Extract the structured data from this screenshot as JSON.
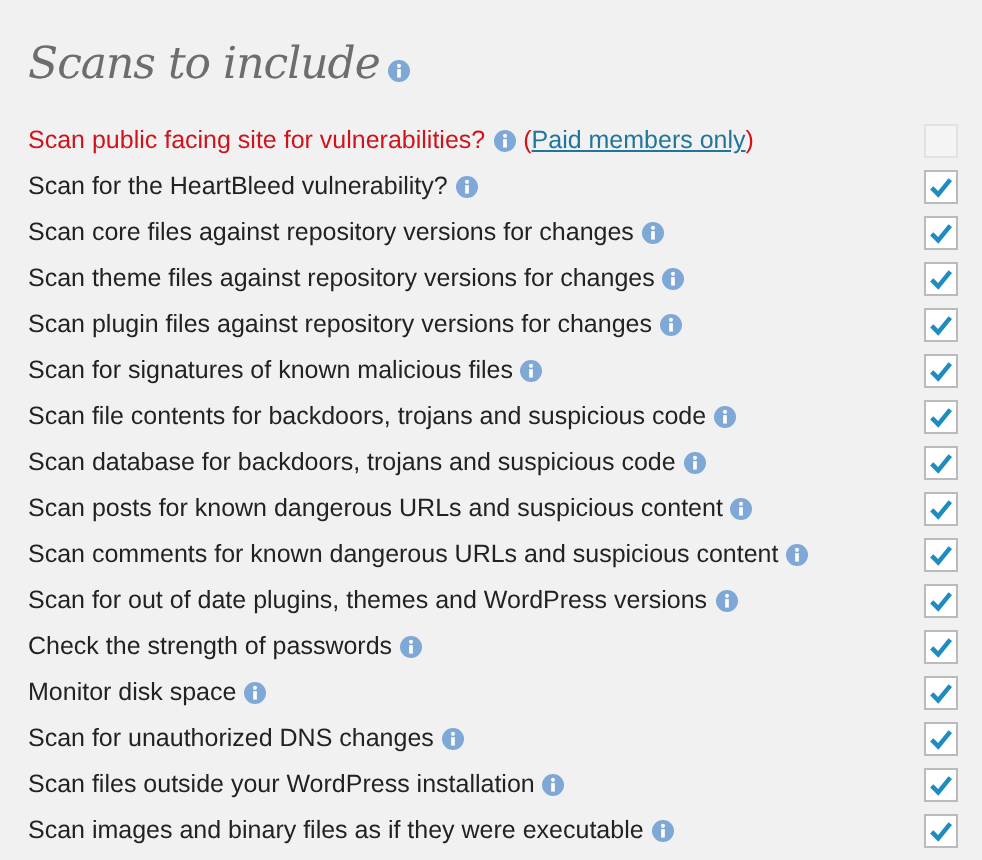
{
  "heading": {
    "text": "Scans to include"
  },
  "options": [
    {
      "kind": "paid",
      "label": "Scan public facing site for vulnerabilities?",
      "note_open": "(",
      "note_link": "Paid members only",
      "note_close": ")",
      "checked": false,
      "disabled": true
    },
    {
      "kind": "standard",
      "label": "Scan for the HeartBleed vulnerability?",
      "checked": true,
      "disabled": false
    },
    {
      "kind": "standard",
      "label": "Scan core files against repository versions for changes",
      "checked": true,
      "disabled": false
    },
    {
      "kind": "standard",
      "label": "Scan theme files against repository versions for changes",
      "checked": true,
      "disabled": false
    },
    {
      "kind": "standard",
      "label": "Scan plugin files against repository versions for changes",
      "checked": true,
      "disabled": false
    },
    {
      "kind": "standard",
      "label": "Scan for signatures of known malicious files",
      "checked": true,
      "disabled": false
    },
    {
      "kind": "standard",
      "label": "Scan file contents for backdoors, trojans and suspicious code",
      "checked": true,
      "disabled": false
    },
    {
      "kind": "standard",
      "label": "Scan database for backdoors, trojans and suspicious code",
      "checked": true,
      "disabled": false
    },
    {
      "kind": "standard",
      "label": "Scan posts for known dangerous URLs and suspicious content",
      "checked": true,
      "disabled": false
    },
    {
      "kind": "standard",
      "label": "Scan comments for known dangerous URLs and suspicious content",
      "checked": true,
      "disabled": false
    },
    {
      "kind": "standard",
      "label": "Scan for out of date plugins, themes and WordPress versions",
      "checked": true,
      "disabled": false
    },
    {
      "kind": "standard",
      "label": "Check the strength of passwords",
      "checked": true,
      "disabled": false
    },
    {
      "kind": "standard",
      "label": "Monitor disk space",
      "checked": true,
      "disabled": false
    },
    {
      "kind": "standard",
      "label": "Scan for unauthorized DNS changes",
      "checked": true,
      "disabled": false
    },
    {
      "kind": "standard",
      "label": "Scan files outside your WordPress installation",
      "checked": true,
      "disabled": false
    },
    {
      "kind": "standard",
      "label": "Scan images and binary files as if they were executable",
      "checked": true,
      "disabled": false
    }
  ]
}
